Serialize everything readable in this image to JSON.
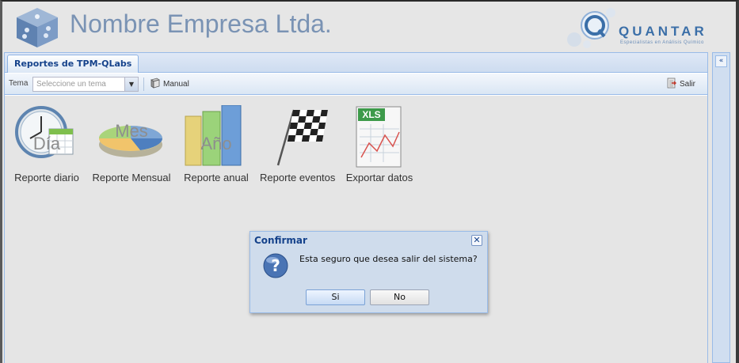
{
  "header": {
    "company_name": "Nombre Empresa Ltda.",
    "brand_name": "QUANTAR",
    "brand_tagline": "Especialistas en Análisis Químico"
  },
  "tabs": [
    {
      "label": "Reportes de TPM-QLabs"
    }
  ],
  "toolbar": {
    "tema_label": "Tema",
    "tema_placeholder": "Seleccione un tema",
    "manual_label": "Manual",
    "exit_label": "Salir"
  },
  "shortcuts": [
    {
      "label": "Reporte diario",
      "art_text": "Día",
      "icon": "calendar-clock-icon"
    },
    {
      "label": "Reporte Mensual",
      "art_text": "Mes",
      "icon": "pie-chart-icon"
    },
    {
      "label": "Reporte anual",
      "art_text": "Año",
      "icon": "bar-chart-icon"
    },
    {
      "label": "Reporte eventos",
      "art_text": "",
      "icon": "checkered-flag-icon"
    },
    {
      "label": "Exportar datos",
      "art_text": "XLS",
      "icon": "spreadsheet-icon"
    }
  ],
  "dialog": {
    "title": "Confirmar",
    "message": "Esta seguro que desea salir del sistema?",
    "yes_label": "Si",
    "no_label": "No",
    "icon": "question-icon"
  },
  "colors": {
    "accent": "#15428b",
    "panel_border": "#99bbe8",
    "company_text": "#7a93b4",
    "background": "#e5e5e5"
  }
}
